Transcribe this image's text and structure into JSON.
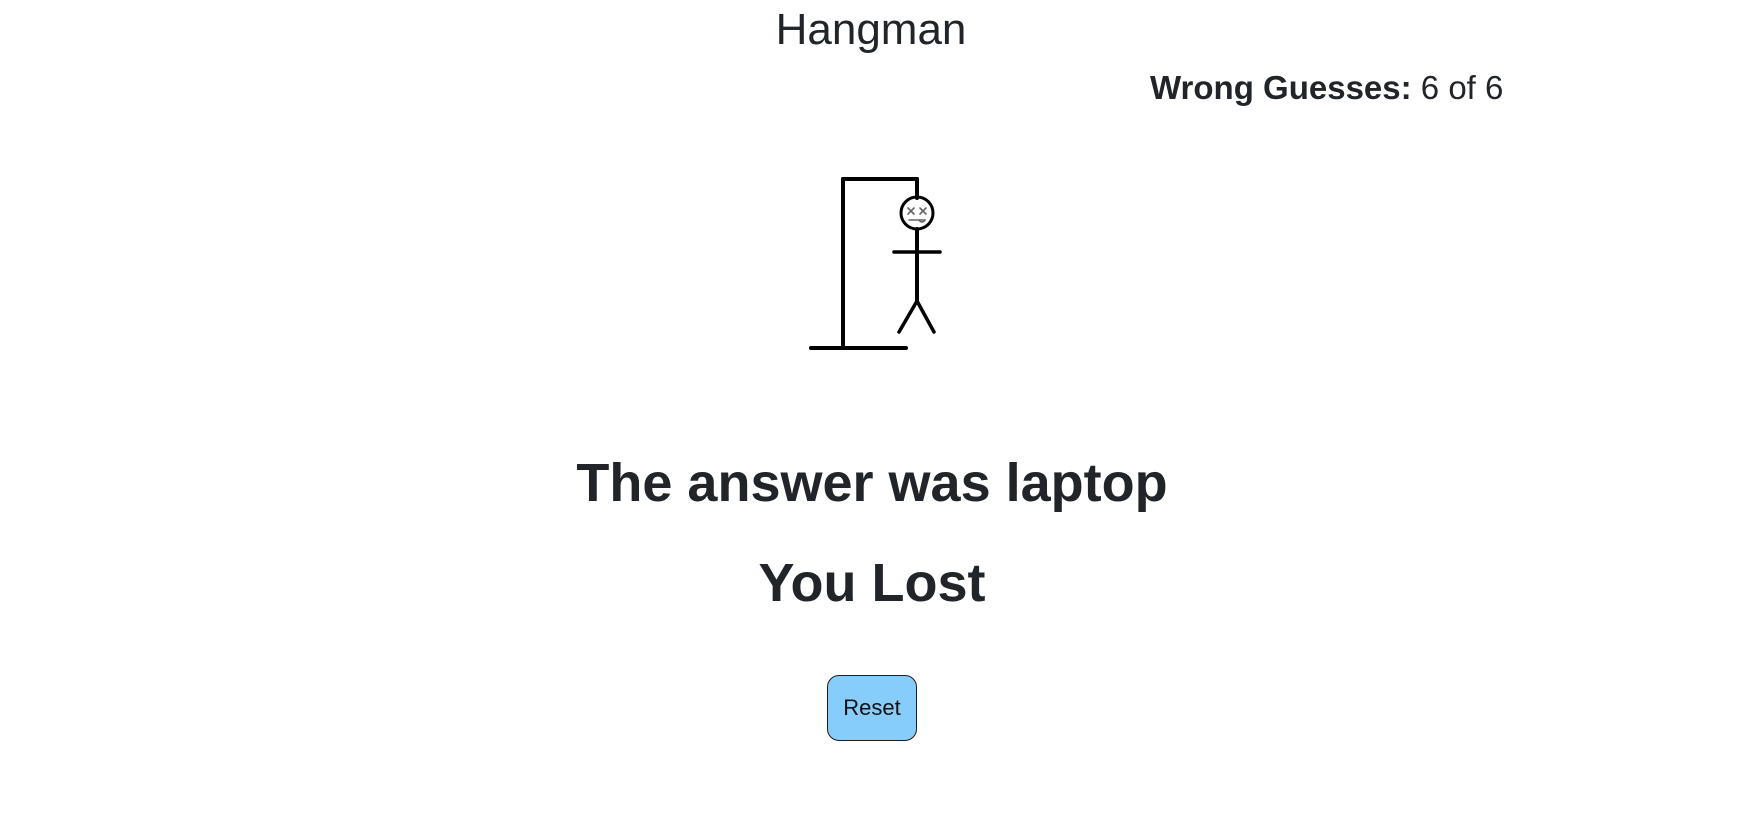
{
  "header": {
    "title": "Hangman"
  },
  "score": {
    "label": "Wrong Guesses:",
    "value": "6 of 6"
  },
  "result": {
    "answer_text": "The answer was laptop",
    "status_text": "You Lost"
  },
  "controls": {
    "reset_label": "Reset"
  },
  "colors": {
    "text": "#212529",
    "button_bg": "#87cdfb",
    "button_border": "#1d1d1d",
    "drawing": "#000000"
  },
  "game": {
    "wrong_guesses": 6,
    "max_guesses": 6
  }
}
